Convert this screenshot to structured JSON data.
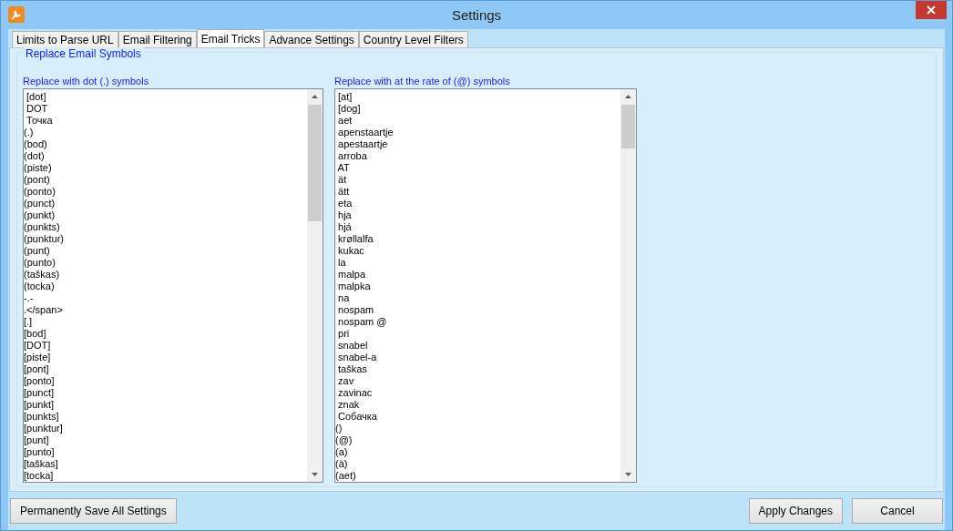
{
  "window": {
    "title": "Settings"
  },
  "tabs": [
    {
      "label": "Limits to Parse URL",
      "selected": false
    },
    {
      "label": "Email Filtering",
      "selected": false
    },
    {
      "label": "Email Tricks",
      "selected": true
    },
    {
      "label": "Advance Settings",
      "selected": false
    },
    {
      "label": "Country Level Filters",
      "selected": false
    }
  ],
  "group": {
    "title": "Replace Email Symbols"
  },
  "lists": [
    {
      "label": "Replace with dot (.) symbols",
      "items": [
        " [dot]",
        " DOT",
        " Точка",
        "(.)",
        "(bod)",
        "(dot)",
        "(piste)",
        "(pont)",
        "(ponto)",
        "(punct)",
        "(punkt)",
        "(punkts)",
        "(punktur)",
        "(punt)",
        "(punto)",
        "(taškas)",
        "(tocka)",
        "-.-",
        ".</span>",
        "[.]",
        "[bod]",
        "[DOT]",
        "[piste]",
        "[pont]",
        "[ponto]",
        "[punct]",
        "[punkt]",
        "[punkts]",
        "[punktur]",
        "[punt]",
        "[punto]",
        "[taškas]",
        "[tocka]"
      ]
    },
    {
      "label": "Replace with at the rate of (@) symbols",
      "items": [
        " [at]",
        " [dog]",
        " aet",
        " apenstaartje",
        " apestaartje",
        " arroba",
        " AT",
        " ät",
        " ätt",
        " eta",
        " hja",
        " hjá",
        " krøllalfa",
        " kukac",
        " la",
        " malpa",
        " malpka",
        " na",
        " nospam",
        " nospam @",
        " pri",
        " snabel",
        " snabel-a",
        " taškas",
        " zav",
        " zavinac",
        " znak",
        " Собачка",
        "()",
        "(@)",
        "(a)",
        "(à)",
        "(aet)"
      ]
    }
  ],
  "footer": {
    "left_buttons": [
      "Permanently Save All Settings"
    ],
    "right_buttons": [
      "Apply Changes",
      "Cancel"
    ]
  }
}
